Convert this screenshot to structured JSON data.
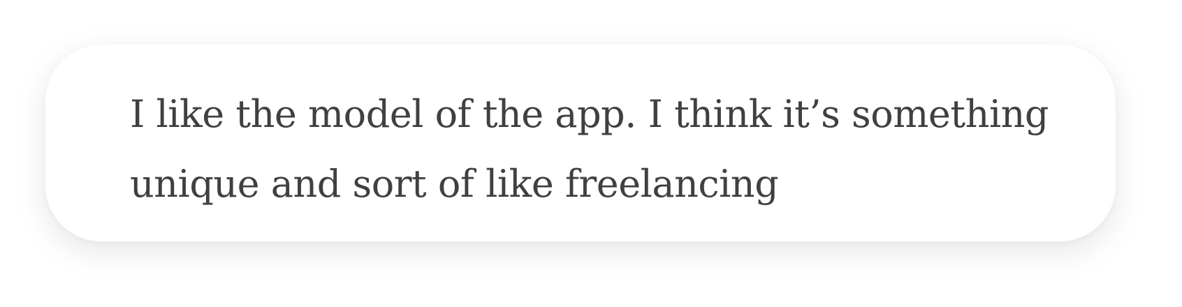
{
  "card": {
    "quote": "I like the model of the app. I think it’s something unique and sort of like freelancing"
  },
  "colors": {
    "text": "#404040",
    "card_background": "#ffffff",
    "page_background": "#ffffff"
  }
}
